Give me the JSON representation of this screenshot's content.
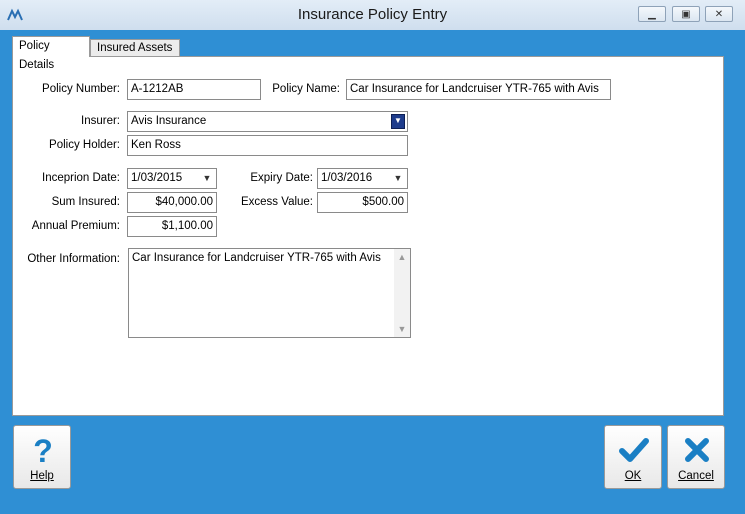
{
  "window": {
    "title": "Insurance Policy Entry"
  },
  "tabs": [
    {
      "label": "Policy Details",
      "active": true
    },
    {
      "label": "Insured Assets",
      "active": false
    }
  ],
  "form": {
    "policy_number": {
      "label": "Policy Number:",
      "value": "A-1212AB"
    },
    "policy_name": {
      "label": "Policy Name:",
      "value": "Car Insurance for Landcruiser YTR-765 with Avis"
    },
    "insurer": {
      "label": "Insurer:",
      "value": "Avis Insurance"
    },
    "policy_holder": {
      "label": "Policy Holder:",
      "value": "Ken Ross"
    },
    "inception_date": {
      "label": "Inceprion Date:",
      "value": "1/03/2015"
    },
    "expiry_date": {
      "label": "Expiry Date:",
      "value": "1/03/2016"
    },
    "sum_insured": {
      "label": "Sum Insured:",
      "value": "$40,000.00"
    },
    "excess_value": {
      "label": "Excess Value:",
      "value": "$500.00"
    },
    "annual_premium": {
      "label": "Annual Premium:",
      "value": "$1,100.00"
    },
    "other_information": {
      "label": "Other Information:",
      "value": "Car Insurance for Landcruiser YTR-765 with Avis"
    }
  },
  "buttons": {
    "help": "Help",
    "ok": "OK",
    "cancel": "Cancel"
  },
  "colors": {
    "frame": "#2f8fd4",
    "ok_icon": "#1a7fc4",
    "cancel_icon": "#1a7fc4"
  }
}
